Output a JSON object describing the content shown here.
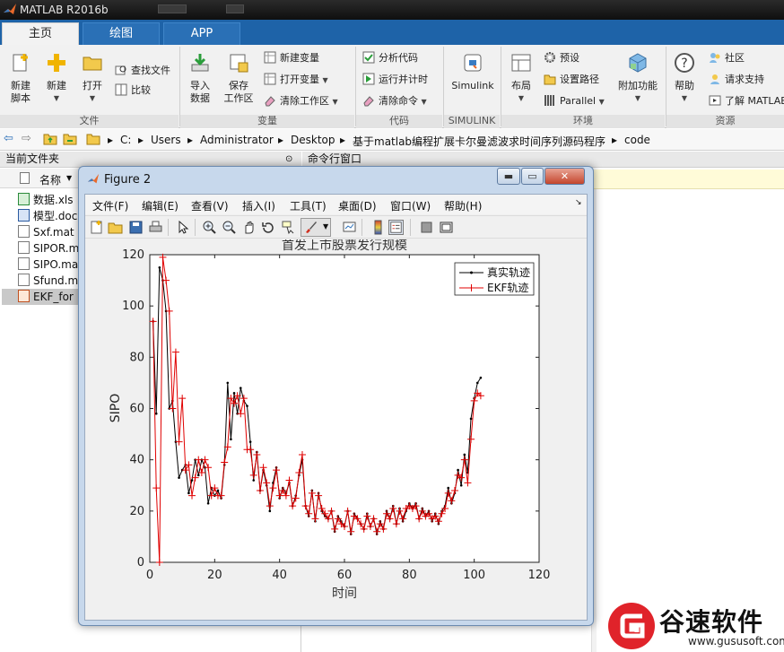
{
  "app": {
    "title": "MATLAB R2016b"
  },
  "tabs": [
    "主页",
    "绘图",
    "APP"
  ],
  "ribbon": {
    "file_group": {
      "label": "文件",
      "new_script": [
        "新建",
        "脚本"
      ],
      "new": "新建",
      "open": "打开",
      "find_files": "查找文件",
      "compare": "比较"
    },
    "variable_group": {
      "label": "变量",
      "import": [
        "导入",
        "数据"
      ],
      "save_workspace": [
        "保存",
        "工作区"
      ],
      "new_variable": "新建变量",
      "open_variable": "打开变量",
      "clear_workspace": "清除工作区"
    },
    "code_group": {
      "label": "代码",
      "analyze": "分析代码",
      "run_time": "运行并计时",
      "clear_commands": "清除命令"
    },
    "simulink_group": {
      "label": "SIMULINK",
      "simulink": "Simulink"
    },
    "env_group": {
      "label": "环境",
      "layout": "布局",
      "preferences": "预设",
      "set_path": "设置路径",
      "parallel": "Parallel",
      "addons": "附加功能"
    },
    "resources_group": {
      "label": "资源",
      "help": "帮助",
      "community": "社区",
      "request_support": "请求支持",
      "learn": "了解 MATLAB"
    }
  },
  "address": {
    "path": [
      "C:",
      "Users",
      "Administrator",
      "Desktop",
      "基于matlab编程扩展卡尔曼滤波求时间序列源码程序",
      "code"
    ]
  },
  "current_folder": {
    "title": "当前文件夹",
    "column_name": "名称",
    "files": [
      {
        "name": "数据.xls",
        "icon": "excel-file-icon"
      },
      {
        "name": "模型.doc",
        "icon": "word-file-icon"
      },
      {
        "name": "Sxf.mat",
        "icon": "mat-file-icon"
      },
      {
        "name": "SIPOR.m",
        "icon": "mat-file-icon"
      },
      {
        "name": "SIPO.ma",
        "icon": "mat-file-icon"
      },
      {
        "name": "Sfund.m",
        "icon": "mat-file-icon"
      },
      {
        "name": "EKF_for",
        "icon": "matlab-script-icon"
      }
    ]
  },
  "command_window": {
    "title": "命令行窗口"
  },
  "figure": {
    "title": "Figure 2",
    "menu": [
      "文件(F)",
      "编辑(E)",
      "查看(V)",
      "插入(I)",
      "工具(T)",
      "桌面(D)",
      "窗口(W)",
      "帮助(H)"
    ],
    "toolbar_icons": [
      "new-figure-icon",
      "open-file-icon",
      "save-icon",
      "print-icon",
      "pointer-icon",
      "zoom-in-icon",
      "zoom-out-icon",
      "pan-icon",
      "rotate-icon",
      "data-cursor-icon",
      "brush-icon",
      "link-plot-icon",
      "colorbar-icon",
      "legend-icon",
      "hide-plot-tools-icon",
      "show-plot-tools-icon"
    ]
  },
  "chart_data": {
    "type": "line",
    "title": "首发上市股票发行规模",
    "xlabel": "时间",
    "ylabel": "SIPO",
    "xlim": [
      0,
      120
    ],
    "ylim": [
      0,
      120
    ],
    "xticks": [
      0,
      20,
      40,
      60,
      80,
      100,
      120
    ],
    "yticks": [
      0,
      20,
      40,
      60,
      80,
      100,
      120
    ],
    "grid": false,
    "legend_position": "top-right",
    "series": [
      {
        "name": "真实轨迹",
        "color": "#000000",
        "marker": "dot",
        "x": [
          1,
          2,
          3,
          4,
          5,
          6,
          7,
          8,
          9,
          10,
          11,
          12,
          13,
          14,
          15,
          16,
          17,
          18,
          19,
          20,
          21,
          22,
          23,
          24,
          25,
          26,
          27,
          28,
          29,
          30,
          31,
          32,
          33,
          34,
          35,
          36,
          37,
          38,
          39,
          40,
          41,
          42,
          43,
          44,
          45,
          46,
          47,
          48,
          49,
          50,
          51,
          52,
          53,
          54,
          55,
          56,
          57,
          58,
          59,
          60,
          61,
          62,
          63,
          64,
          65,
          66,
          67,
          68,
          69,
          70,
          71,
          72,
          73,
          74,
          75,
          76,
          77,
          78,
          79,
          80,
          81,
          82,
          83,
          84,
          85,
          86,
          87,
          88,
          89,
          90,
          91,
          92,
          93,
          94,
          95,
          96,
          97,
          98,
          99,
          100,
          101,
          102
        ],
        "y": [
          94,
          58,
          115,
          110,
          98,
          60,
          63,
          47,
          33,
          36,
          38,
          27,
          32,
          40,
          34,
          40,
          37,
          23,
          29,
          26,
          28,
          25,
          38,
          70,
          48,
          66,
          58,
          68,
          63,
          61,
          47,
          32,
          43,
          28,
          36,
          30,
          20,
          31,
          37,
          25,
          29,
          27,
          31,
          22,
          26,
          34,
          40,
          22,
          18,
          28,
          16,
          27,
          20,
          18,
          17,
          20,
          12,
          18,
          16,
          14,
          20,
          11,
          19,
          17,
          15,
          13,
          19,
          14,
          17,
          11,
          16,
          13,
          20,
          17,
          22,
          15,
          21,
          16,
          20,
          23,
          21,
          23,
          17,
          21,
          18,
          20,
          16,
          19,
          15,
          20,
          22,
          29,
          23,
          27,
          36,
          30,
          42,
          35,
          56,
          64,
          70,
          72
        ]
      },
      {
        "name": "EKF轨迹",
        "color": "#e00000",
        "marker": "plus",
        "x": [
          1,
          2,
          3,
          4,
          5,
          6,
          7,
          8,
          9,
          10,
          11,
          12,
          13,
          14,
          15,
          16,
          17,
          18,
          19,
          20,
          21,
          22,
          23,
          24,
          25,
          26,
          27,
          28,
          29,
          30,
          31,
          32,
          33,
          34,
          35,
          36,
          37,
          38,
          39,
          40,
          41,
          42,
          43,
          44,
          45,
          46,
          47,
          48,
          49,
          50,
          51,
          52,
          53,
          54,
          55,
          56,
          57,
          58,
          59,
          60,
          61,
          62,
          63,
          64,
          65,
          66,
          67,
          68,
          69,
          70,
          71,
          72,
          73,
          74,
          75,
          76,
          77,
          78,
          79,
          80,
          81,
          82,
          83,
          84,
          85,
          86,
          87,
          88,
          89,
          90,
          91,
          92,
          93,
          94,
          95,
          96,
          97,
          98,
          99,
          100,
          101,
          102
        ],
        "y": [
          94,
          29,
          0,
          119,
          110,
          98,
          60,
          82,
          47,
          64,
          36,
          38,
          26,
          33,
          40,
          35,
          40,
          37,
          26,
          29,
          26,
          26,
          39,
          45,
          64,
          62,
          65,
          58,
          64,
          44,
          44,
          34,
          42,
          28,
          37,
          31,
          22,
          29,
          36,
          26,
          28,
          26,
          32,
          22,
          25,
          35,
          42,
          22,
          19,
          27,
          17,
          26,
          21,
          19,
          17,
          20,
          13,
          17,
          15,
          14,
          20,
          12,
          18,
          17,
          15,
          13,
          18,
          14,
          17,
          12,
          15,
          13,
          19,
          17,
          21,
          15,
          20,
          17,
          21,
          22,
          21,
          22,
          17,
          20,
          18,
          19,
          17,
          18,
          16,
          19,
          21,
          27,
          24,
          28,
          34,
          33,
          40,
          31,
          48,
          63,
          66,
          65
        ]
      }
    ]
  },
  "watermark": {
    "text": "谷速软件",
    "url": "www.gususoft.com"
  }
}
